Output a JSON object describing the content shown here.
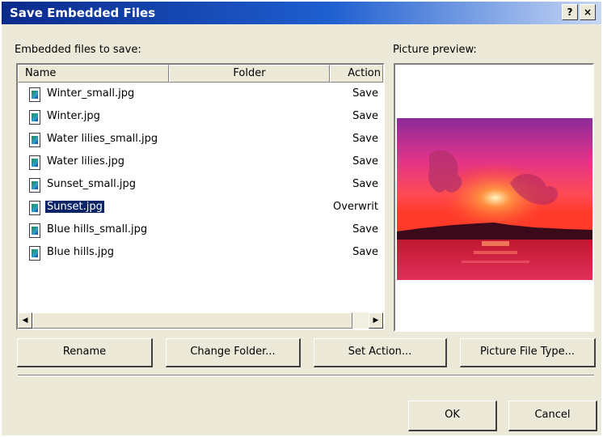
{
  "window": {
    "title": "Save Embedded Files",
    "help_label": "?",
    "close_label": "×"
  },
  "files_label": "Embedded files to save:",
  "preview_label": "Picture preview:",
  "columns": {
    "name": "Name",
    "folder": "Folder",
    "action": "Action"
  },
  "files": [
    {
      "name": "Winter_small.jpg",
      "folder": "",
      "action": "Save",
      "selected": false
    },
    {
      "name": "Winter.jpg",
      "folder": "",
      "action": "Save",
      "selected": false
    },
    {
      "name": "Water lilies_small.jpg",
      "folder": "",
      "action": "Save",
      "selected": false
    },
    {
      "name": "Water lilies.jpg",
      "folder": "",
      "action": "Save",
      "selected": false
    },
    {
      "name": "Sunset_small.jpg",
      "folder": "",
      "action": "Save",
      "selected": false
    },
    {
      "name": "Sunset.jpg",
      "folder": "",
      "action": "Overwrit",
      "selected": true
    },
    {
      "name": "Blue hills_small.jpg",
      "folder": "",
      "action": "Save",
      "selected": false
    },
    {
      "name": "Blue hills.jpg",
      "folder": "",
      "action": "Save",
      "selected": false
    }
  ],
  "scrollbar": {
    "left_arrow": "◀",
    "right_arrow": "▶"
  },
  "buttons": {
    "rename": "Rename",
    "change_folder": "Change Folder...",
    "set_action": "Set Action...",
    "picture_file_type": "Picture File Type...",
    "ok": "OK",
    "cancel": "Cancel"
  },
  "colors": {
    "title_bar": "#0b2a8c",
    "dialog_face": "#ece9d8",
    "selection": "#0a246a"
  },
  "icons": {
    "file": "jpeg-file-icon",
    "preview": "sunset-image"
  }
}
